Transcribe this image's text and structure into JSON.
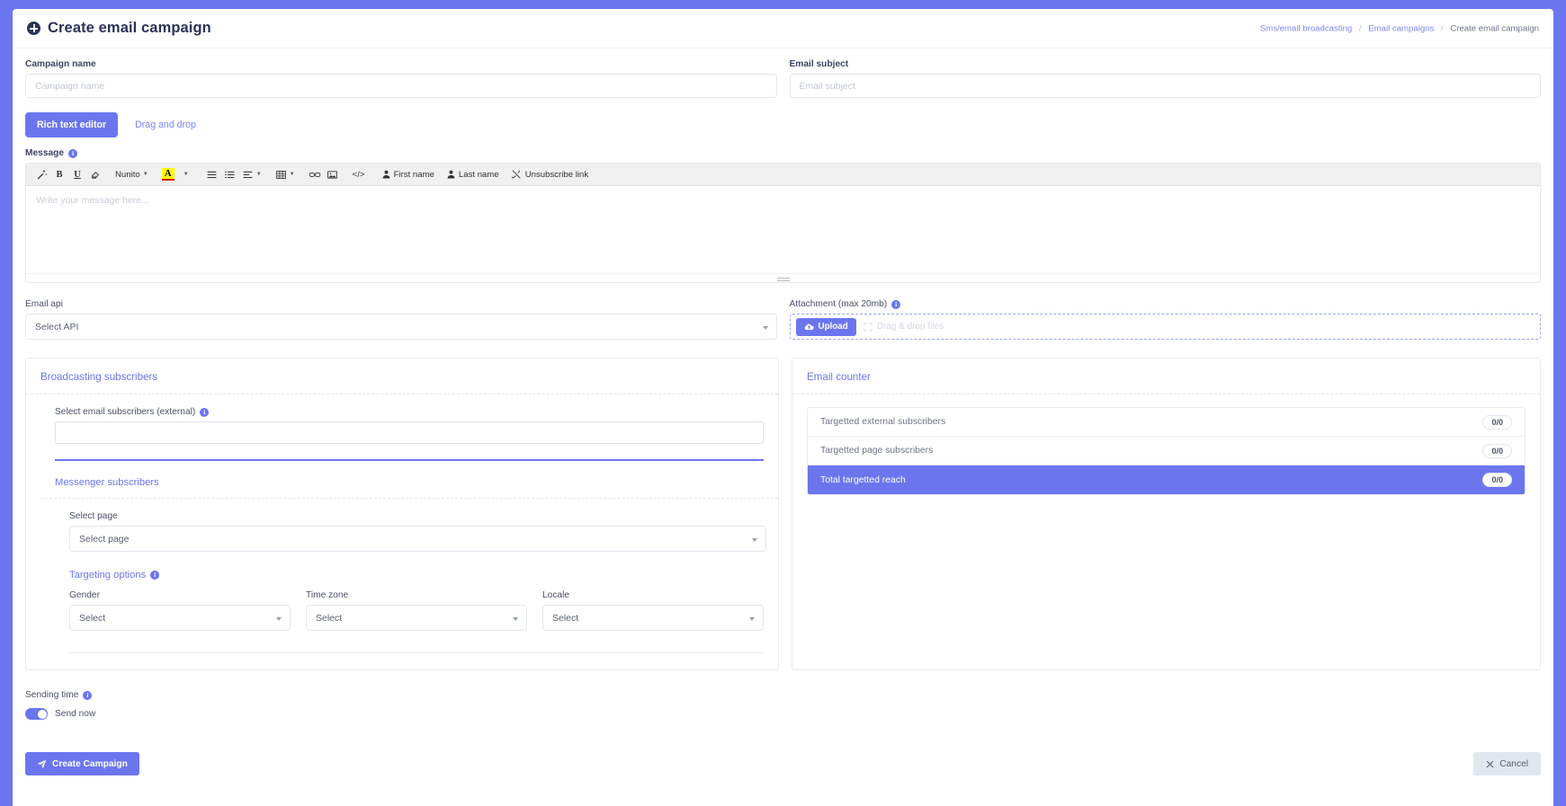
{
  "header": {
    "title": "Create email campaign",
    "add_icon": "plus-circle-icon",
    "breadcrumb": {
      "items": [
        {
          "label": "Sms/email broadcasting",
          "link": true
        },
        {
          "label": "Email campaigns",
          "link": true
        },
        {
          "label": "Create email campaign",
          "link": false
        }
      ],
      "separator": "/"
    }
  },
  "form": {
    "campaign_name": {
      "label": "Campaign name",
      "placeholder": "Campaign name",
      "value": ""
    },
    "email_subject": {
      "label": "Email subject",
      "placeholder": "Email subject",
      "value": ""
    }
  },
  "tabs": [
    {
      "label": "Rich text editor",
      "active": true
    },
    {
      "label": "Drag and drop",
      "active": false
    }
  ],
  "message": {
    "label": "Message",
    "info_icon": "info-icon",
    "placeholder": "Write your message here...",
    "toolbar": {
      "style_icon": "magic-wand-icon",
      "bold": "B",
      "underline": "U",
      "eraser_icon": "eraser-icon",
      "font_name": "Nunito",
      "font_color": "A",
      "unordered_list_icon": "unordered-list-icon",
      "ordered_list_icon": "ordered-list-icon",
      "align_icon": "align-left-icon",
      "table_icon": "table-icon",
      "link_icon": "link-icon",
      "image_icon": "image-icon",
      "code_icon": "code-view-icon",
      "first_name": "First name",
      "last_name": "Last name",
      "unsubscribe_link": "Unsubscribe link"
    }
  },
  "email_api": {
    "label": "Email api",
    "selected": "Select API"
  },
  "attachment": {
    "label": "Attachment (max 20mb)",
    "info_icon": "info-icon",
    "upload_label": "Upload",
    "upload_icon": "cloud-upload-icon",
    "dropzone_text": "Drag & drop files",
    "dropzone_icon": "arrows-move-icon"
  },
  "broadcasting": {
    "title": "Broadcasting subscribers",
    "external": {
      "label": "Select email subscribers (external)",
      "info_icon": "info-icon",
      "value": ""
    },
    "messenger": {
      "title": "Messenger subscribers",
      "select_page": {
        "label": "Select page",
        "selected": "Select page"
      }
    },
    "targeting": {
      "title": "Targeting options",
      "info_icon": "info-icon",
      "fields": [
        {
          "label": "Gender",
          "selected": "Select"
        },
        {
          "label": "Time zone",
          "selected": "Select"
        },
        {
          "label": "Locale",
          "selected": "Select"
        }
      ]
    }
  },
  "email_counter": {
    "title": "Email counter",
    "rows": [
      {
        "label": "Targetted external subscribers",
        "value": "0/0",
        "highlight": false
      },
      {
        "label": "Targetted page subscribers",
        "value": "0/0",
        "highlight": false
      },
      {
        "label": "Total targetted reach",
        "value": "0/0",
        "highlight": true
      }
    ]
  },
  "sending_time": {
    "label": "Sending time",
    "info_icon": "info-icon",
    "toggle_label": "Send now",
    "toggle_on": true
  },
  "footer": {
    "create_label": "Create Campaign",
    "create_icon": "paper-plane-icon",
    "cancel_label": "Cancel",
    "cancel_icon": "close-x-icon"
  },
  "colors": {
    "accent": "#6b76ee",
    "page_background": "#6b76ee",
    "title": "#2b3356",
    "muted": "#7a8095"
  }
}
